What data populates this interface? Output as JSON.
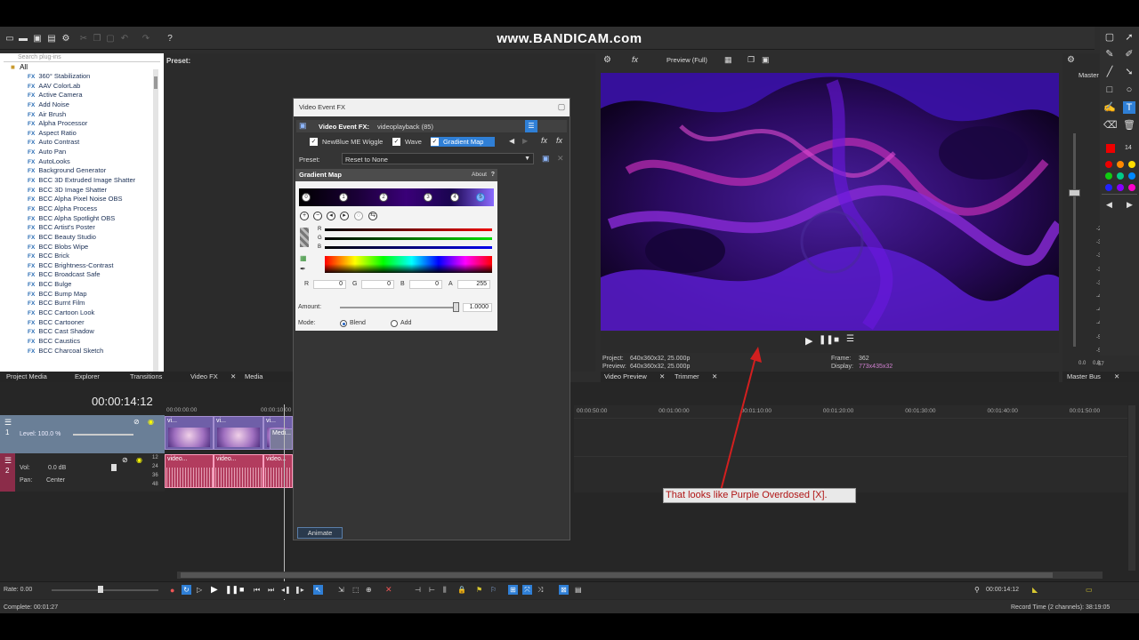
{
  "watermark": "www.BANDICAM.com",
  "plugins": {
    "search_placeholder": "Search plug-ins",
    "root": "All",
    "items": [
      "360° Stabilization",
      "AAV ColorLab",
      "Active Camera",
      "Add Noise",
      "Air Brush",
      "Alpha Processor",
      "Aspect Ratio",
      "Auto Contrast",
      "Auto Pan",
      "AutoLooks",
      "Background Generator",
      "BCC 3D Extruded Image Shatter",
      "BCC 3D Image Shatter",
      "BCC Alpha Pixel Noise OBS",
      "BCC Alpha Process",
      "BCC Alpha Spotlight OBS",
      "BCC Artist's Poster",
      "BCC Beauty Studio",
      "BCC Blobs Wipe",
      "BCC Brick",
      "BCC Brightness-Contrast",
      "BCC Broadcast Safe",
      "BCC Bulge",
      "BCC Bump Map",
      "BCC Burnt Film",
      "BCC Cartoon Look",
      "BCC Cartooner",
      "BCC Cast Shadow",
      "BCC Caustics",
      "BCC Charcoal Sketch"
    ],
    "fx_badge": "FX"
  },
  "preset_header": "Preset:",
  "left_tabs": [
    "Project Media",
    "Explorer",
    "Transitions",
    "Video FX",
    "Media Generator"
  ],
  "dialog": {
    "window_title": "Video Event FX",
    "header_label": "Video Event FX:",
    "header_value": "videoplayback (85)",
    "chain": [
      "NewBlue ME Wiggle",
      "Wave",
      "Gradient Map"
    ],
    "preset_label": "Preset:",
    "preset_value": "Reset to None",
    "animate_label": "Animate"
  },
  "gradient_map": {
    "title": "Gradient Map",
    "about": "About",
    "question": "?",
    "stops": [
      "0",
      "1",
      "2",
      "3",
      "4",
      "5"
    ],
    "channels": [
      "R",
      "G",
      "B"
    ],
    "r_label": "R",
    "r_value": "0",
    "g_label": "G",
    "g_value": "0",
    "b_label": "B",
    "b_value": "0",
    "a_label": "A",
    "a_value": "255",
    "amount_label": "Amount:",
    "amount_value": "1.0000",
    "amount_fraction": 0.98,
    "mode_label": "Mode:",
    "mode_blend": "Blend",
    "mode_add": "Add"
  },
  "preview": {
    "toolbar_label": "Preview (Full)",
    "project_label": "Project:",
    "project_value": "640x360x32, 25.000p",
    "preview_label": "Preview:",
    "preview_value": "640x360x32, 25.000p",
    "frame_label": "Frame:",
    "frame_value": "362",
    "display_label": "Display:",
    "display_value": "773x435x32",
    "tabs": [
      "Video Preview",
      "Trimmer"
    ]
  },
  "master_bus": {
    "label": "Master",
    "tab": "Master Bus",
    "scale": [
      "-27",
      "-30",
      "-33",
      "-36",
      "-39",
      "-42",
      "-45",
      "-48",
      "-51",
      "-54",
      "-57"
    ],
    "bottom_left": "0.0",
    "bottom_right": "0.0",
    "top_values": [
      "-6",
      "-7"
    ],
    "size_value": "14"
  },
  "timeline": {
    "timecode": "00:00:14:12",
    "ruler_left": [
      "00:00:00:00",
      "00:00:10:00"
    ],
    "ruler_right": [
      "00:00:50:00",
      "00:01:00:00",
      "00:01:10:00",
      "00:01:20:00",
      "00:01:30:00",
      "00:01:40:00",
      "00:01:50:00"
    ],
    "video_track": {
      "number": "1",
      "level_label": "Level: 100.0 %",
      "clip_labels": [
        "vi...",
        "vi...",
        "vi...",
        "Medi..."
      ]
    },
    "audio_track": {
      "number": "2",
      "vol_label": "Vol:",
      "vol_value": "0.0 dB",
      "pan_label": "Pan:",
      "pan_value": "Center",
      "clip_labels": [
        "video...",
        "video...",
        "video..."
      ],
      "db_marks": [
        "12",
        "24",
        "36",
        "48"
      ]
    },
    "rate_label": "Rate: 0.00",
    "end_timecode": "00:00:14:12"
  },
  "status": {
    "complete": "Complete: 00:01:27",
    "record_time": "Record Time (2 channels): 38:19:05"
  },
  "annotation": "That looks like Purple Overdosed [X].",
  "colors": {
    "accent_blue": "#2f7fd6",
    "annotation_red": "#b01515",
    "arrow_red": "#d21f1f"
  }
}
